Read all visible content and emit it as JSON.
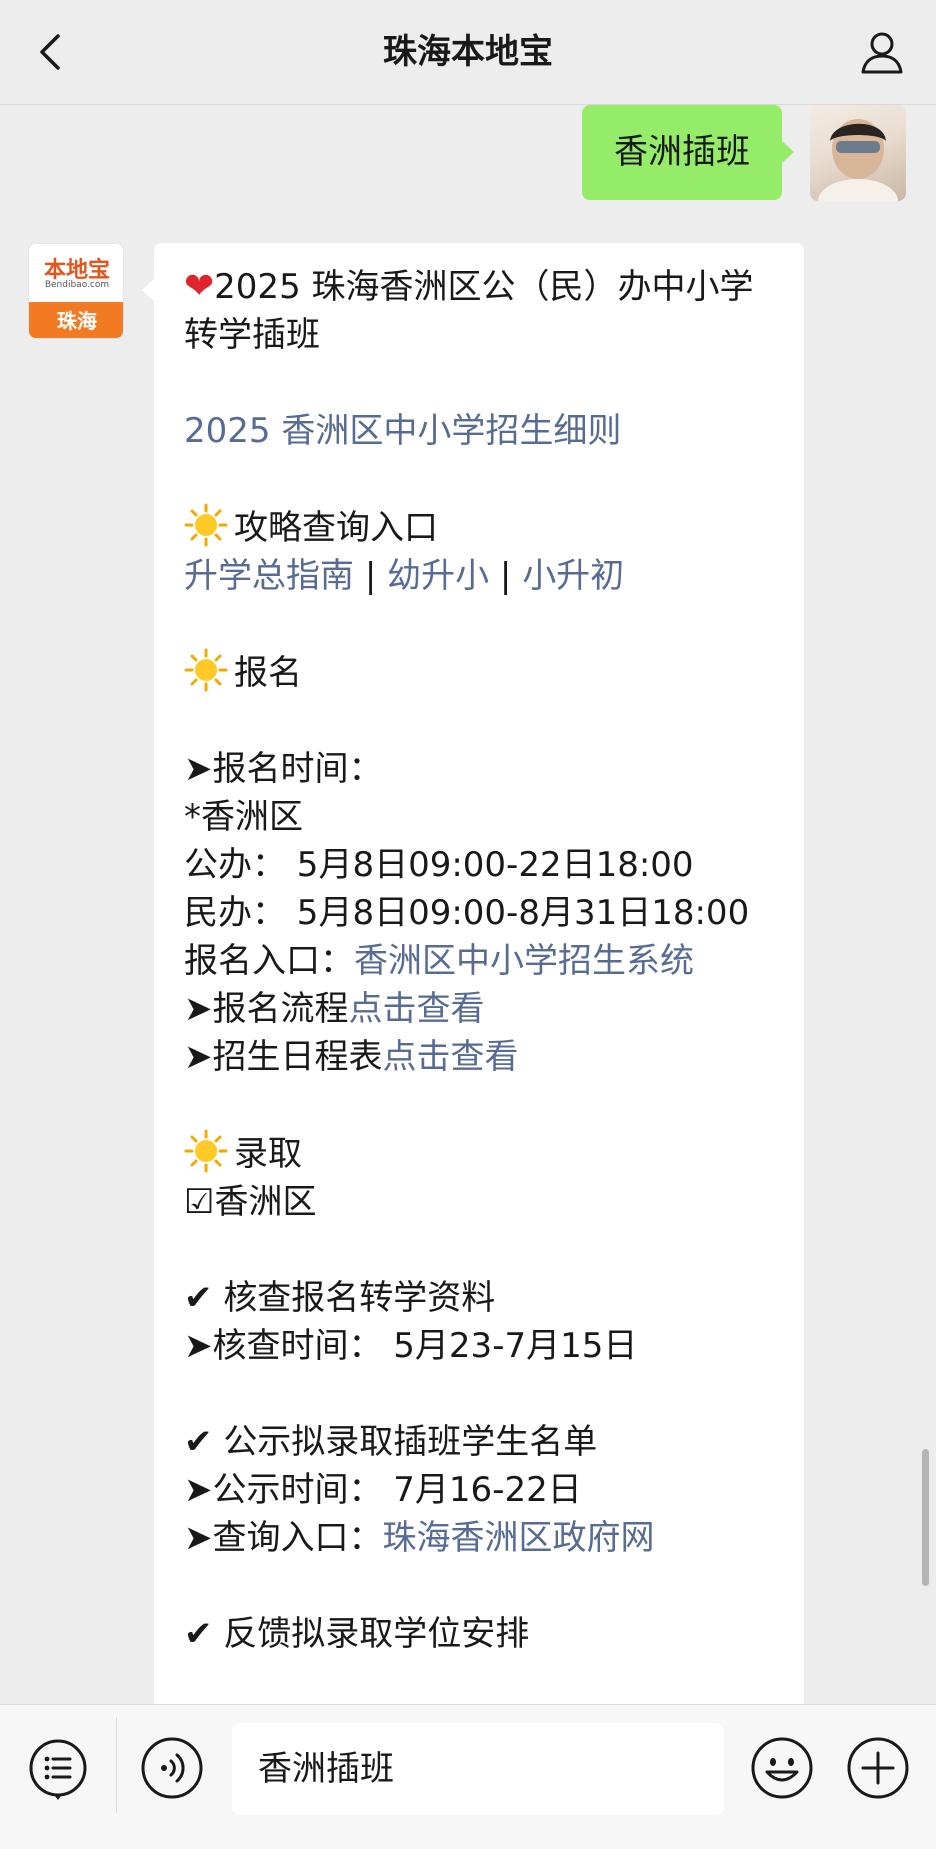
{
  "header": {
    "title": "珠海本地宝",
    "back_icon": "chevron-left-icon",
    "profile_icon": "person-icon"
  },
  "outgoing": {
    "text": "香洲插班"
  },
  "bot_avatar": {
    "brand": "本地宝",
    "sub": "Bendibao.com",
    "city": "珠海"
  },
  "message": {
    "title": "2025 珠海香洲区公（民）办中小学转学插班",
    "rules_link": "2025 香洲区中小学招生细则",
    "guide_heading": "攻略查询入口",
    "guide_links": [
      "升学总指南",
      "幼升小",
      "小升初"
    ],
    "guide_sep": "|",
    "signup_heading": "报名",
    "signup_time_label": "➤报名时间：",
    "district": "*香洲区",
    "public_time": "公办： 5月8日09:00-22日18:00",
    "private_time": "民办： 5月8日09:00-8月31日18:00",
    "entry_label": "报名入口：",
    "entry_link": "香洲区中小学招生系统",
    "process_label": "➤报名流程",
    "process_link": "点击查看",
    "schedule_label": "➤招生日程表",
    "schedule_link": "点击查看",
    "admit_heading": "录取",
    "admit_district": "☑香洲区",
    "check_heading": "核查报名转学资料",
    "check_time": "➤核查时间： 5月23-7月15日",
    "publicity_heading": "公示拟录取插班学生名单",
    "publicity_time": "➤公示时间： 7月16-22日",
    "query_label": "➤查询入口：",
    "query_link": "珠海香洲区政府网",
    "feedback_heading": "反馈拟录取学位安排"
  },
  "bottom_bar": {
    "menu_icon": "menu-list-icon",
    "voice_icon": "voice-icon",
    "input_text": "香洲插班",
    "emoji_icon": "emoji-icon",
    "plus_icon": "plus-icon"
  },
  "colors": {
    "link": "#576b95",
    "bubble_out": "#95ec69",
    "bubble_in": "#ffffff",
    "background": "#ededed"
  }
}
